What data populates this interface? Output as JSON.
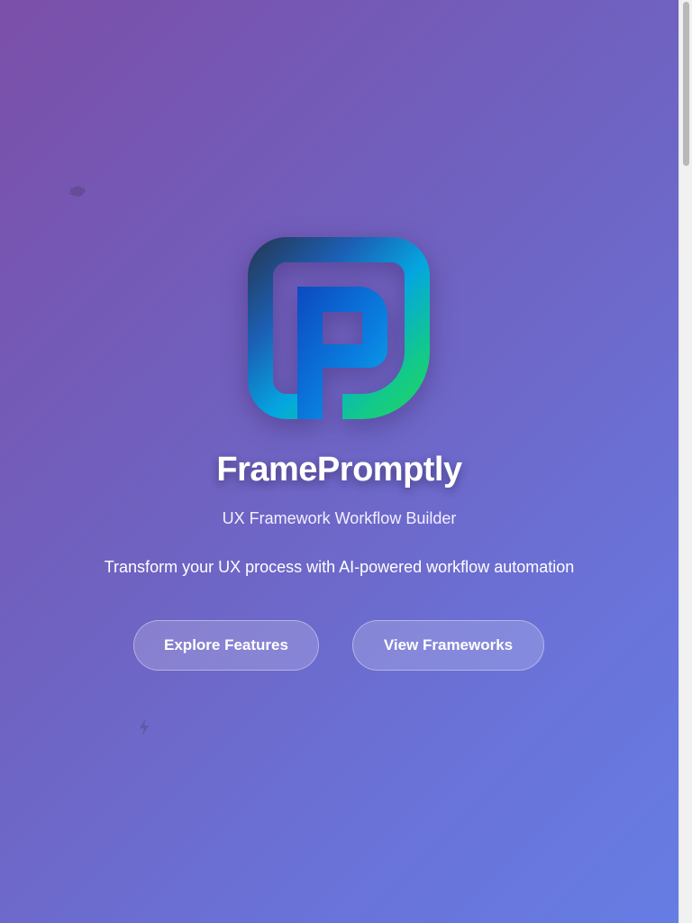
{
  "hero": {
    "background_colors": [
      "#7b4fa9",
      "#6f63c2",
      "#667de3"
    ],
    "decorations": [
      "brain-icon",
      "lightning-icon"
    ]
  },
  "logo": {
    "icon": "p-frame-logo-icon",
    "gradient_colors": [
      "#2a3f5f",
      "#1a6fd6",
      "#00b4e6",
      "#22d46a"
    ]
  },
  "app": {
    "title": "FramePromptly",
    "subtitle": "UX Framework Workflow Builder",
    "tagline": "Transform your UX process with AI-powered workflow automation"
  },
  "actions": {
    "explore_label": "Explore Features",
    "frameworks_label": "View Frameworks"
  }
}
